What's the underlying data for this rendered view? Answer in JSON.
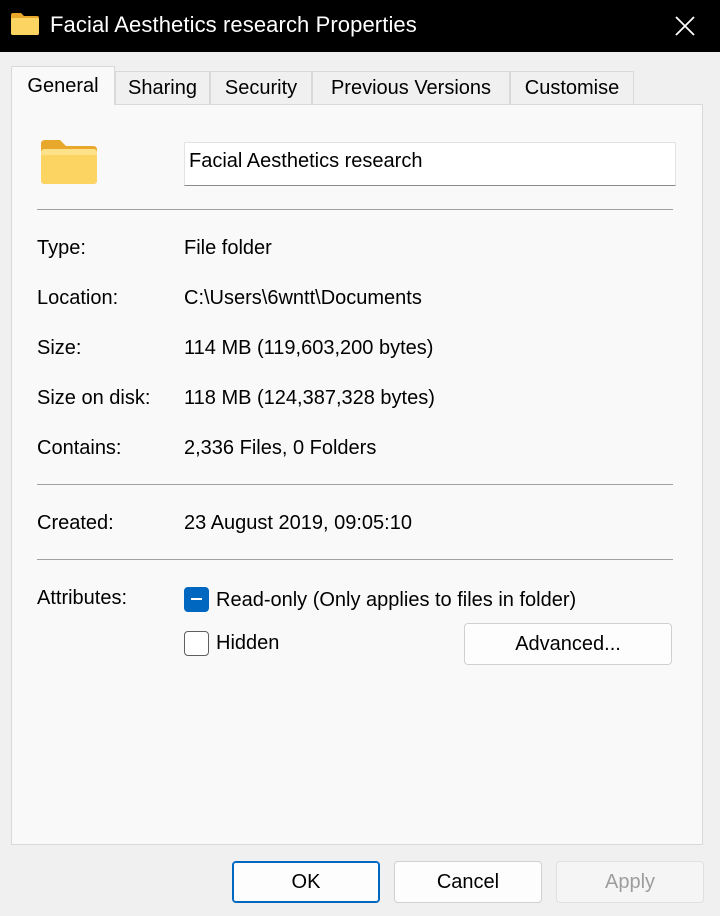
{
  "window": {
    "title": "Facial Aesthetics research Properties",
    "icon": "folder-icon",
    "close_icon": "close-icon"
  },
  "tabs": [
    {
      "label": "General",
      "active": true
    },
    {
      "label": "Sharing",
      "active": false
    },
    {
      "label": "Security",
      "active": false
    },
    {
      "label": "Previous Versions",
      "active": false
    },
    {
      "label": "Customise",
      "active": false
    }
  ],
  "general": {
    "folder_name": "Facial Aesthetics research",
    "properties": [
      {
        "label": "Type:",
        "value": "File folder"
      },
      {
        "label": "Location:",
        "value": "C:\\Users\\6wntt\\Documents"
      },
      {
        "label": "Size:",
        "value": "114 MB (119,603,200 bytes)"
      },
      {
        "label": "Size on disk:",
        "value": "118 MB (124,387,328 bytes)"
      },
      {
        "label": "Contains:",
        "value": "2,336 Files, 0 Folders"
      }
    ],
    "created": {
      "label": "Created:",
      "value": "23 August 2019, 09:05:10"
    },
    "attributes": {
      "label": "Attributes:",
      "readonly": {
        "label": "Read-only (Only applies to files in folder)",
        "state": "indeterminate"
      },
      "hidden": {
        "label": "Hidden",
        "state": "unchecked"
      },
      "advanced_label": "Advanced..."
    }
  },
  "buttons": {
    "ok": "OK",
    "cancel": "Cancel",
    "apply": "Apply"
  },
  "colors": {
    "accent": "#0067c0",
    "titlebar": "#000000",
    "folder": "#f8c94a"
  }
}
